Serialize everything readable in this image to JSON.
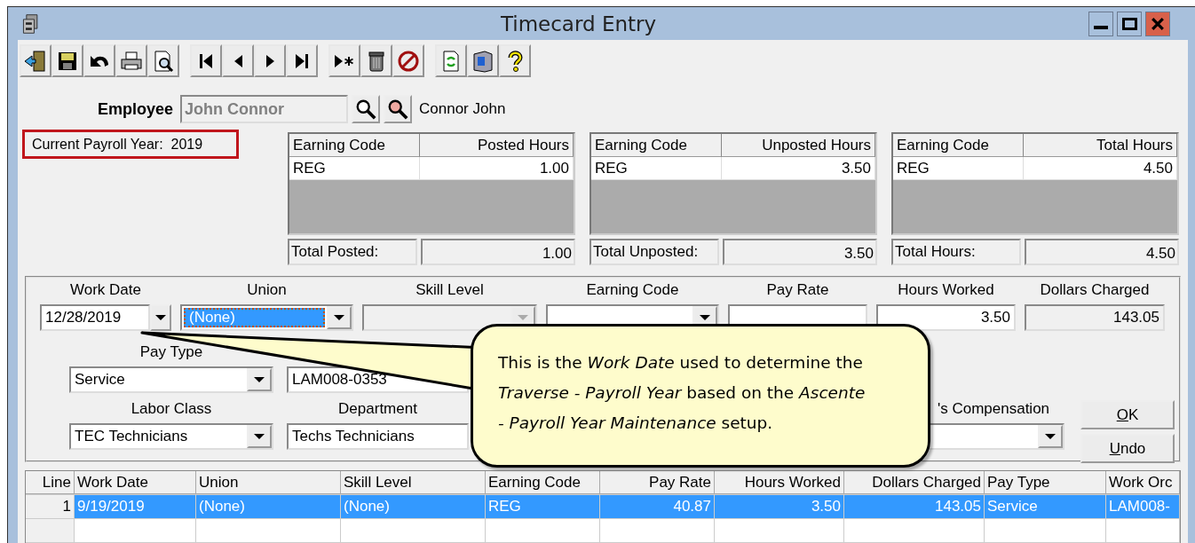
{
  "window": {
    "title": "Timecard Entry"
  },
  "toolbar": [
    [
      {
        "kind": "exit"
      },
      {
        "kind": "save"
      },
      {
        "kind": "undo"
      },
      {
        "kind": "print"
      },
      {
        "kind": "preview"
      }
    ],
    [
      {
        "kind": "first"
      },
      {
        "kind": "prev"
      },
      {
        "kind": "next"
      },
      {
        "kind": "last"
      }
    ],
    [
      {
        "kind": "new"
      },
      {
        "kind": "delete"
      },
      {
        "kind": "cancel"
      }
    ],
    [
      {
        "kind": "refresh"
      },
      {
        "kind": "book"
      },
      {
        "kind": "help"
      }
    ]
  ],
  "employee": {
    "label": "Employee",
    "value": "John Connor",
    "disabled": true,
    "display_name": "Connor John"
  },
  "payroll_year": "Current Payroll Year:  2019",
  "summaries": [
    {
      "columns": [
        "Earning Code",
        "Posted Hours"
      ],
      "rows": [
        [
          "REG",
          "1.00"
        ]
      ],
      "total_label": "Total Posted:",
      "total_value": "1.00"
    },
    {
      "columns": [
        "Earning Code",
        "Unposted Hours"
      ],
      "rows": [
        [
          "REG",
          "3.50"
        ]
      ],
      "total_label": "Total Unposted:",
      "total_value": "3.50"
    },
    {
      "columns": [
        "Earning Code",
        "Total Hours"
      ],
      "rows": [
        [
          "REG",
          "4.50"
        ]
      ],
      "total_label": "Total Hours:",
      "total_value": "4.50"
    }
  ],
  "entry": {
    "top_fields": [
      {
        "label": "Work Date",
        "kind": "date",
        "value": "12/28/2019",
        "highlighted": false,
        "disabled": false
      },
      {
        "label": "Union",
        "kind": "combo",
        "value": "(None)",
        "highlighted": true,
        "disabled": false
      },
      {
        "label": "Skill Level",
        "kind": "combo",
        "highlighted": false,
        "disabled": true
      },
      {
        "label": "Earning Code",
        "kind": "combo",
        "highlighted": false,
        "disabled": false
      },
      {
        "label": "Pay Rate",
        "kind": "number",
        "highlighted": false,
        "disabled": false
      },
      {
        "label": "Hours Worked",
        "kind": "number",
        "value": "3.50",
        "highlighted": false,
        "disabled": false
      },
      {
        "label": "Dollars Charged",
        "kind": "readonly",
        "value": "143.05",
        "highlighted": false,
        "disabled": false
      }
    ],
    "middle_fields": [
      {
        "label": "Pay Type",
        "kind": "combo",
        "value": "Service",
        "highlighted": false,
        "disabled": false
      },
      {
        "kind": "text",
        "value": "LAM008-0353",
        "highlighted": false,
        "disabled": false
      }
    ],
    "bottom_fields": [
      {
        "label": "Labor Class",
        "kind": "combo",
        "value": "TEC   Technicians",
        "highlighted": false,
        "disabled": false
      },
      {
        "label": "Department",
        "kind": "text",
        "value": "Techs   Technicians",
        "highlighted": false,
        "disabled": false
      },
      {
        "label": "'s Compensation",
        "kind": "combo",
        "highlighted": false,
        "disabled": false
      }
    ],
    "buttons": [
      "OK",
      "Undo"
    ]
  },
  "table": {
    "columns": [
      "Line",
      "Work Date",
      "Union",
      "Skill Level",
      "Earning Code",
      "Pay Rate",
      "Hours Worked",
      "Dollars Charged",
      "Pay Type",
      "Work Orc"
    ],
    "rows": [
      {
        "selected": true,
        "cells": [
          "1",
          "9/19/2019",
          "(None)",
          "(None)",
          "REG",
          "40.87",
          "3.50",
          "143.05",
          "Service",
          "LAM008-"
        ]
      }
    ]
  },
  "callout": "This is the *Work Date* used to determine the *Traverse - Payroll Year* based on the *Ascente - Payroll Year Maintenance* setup."
}
